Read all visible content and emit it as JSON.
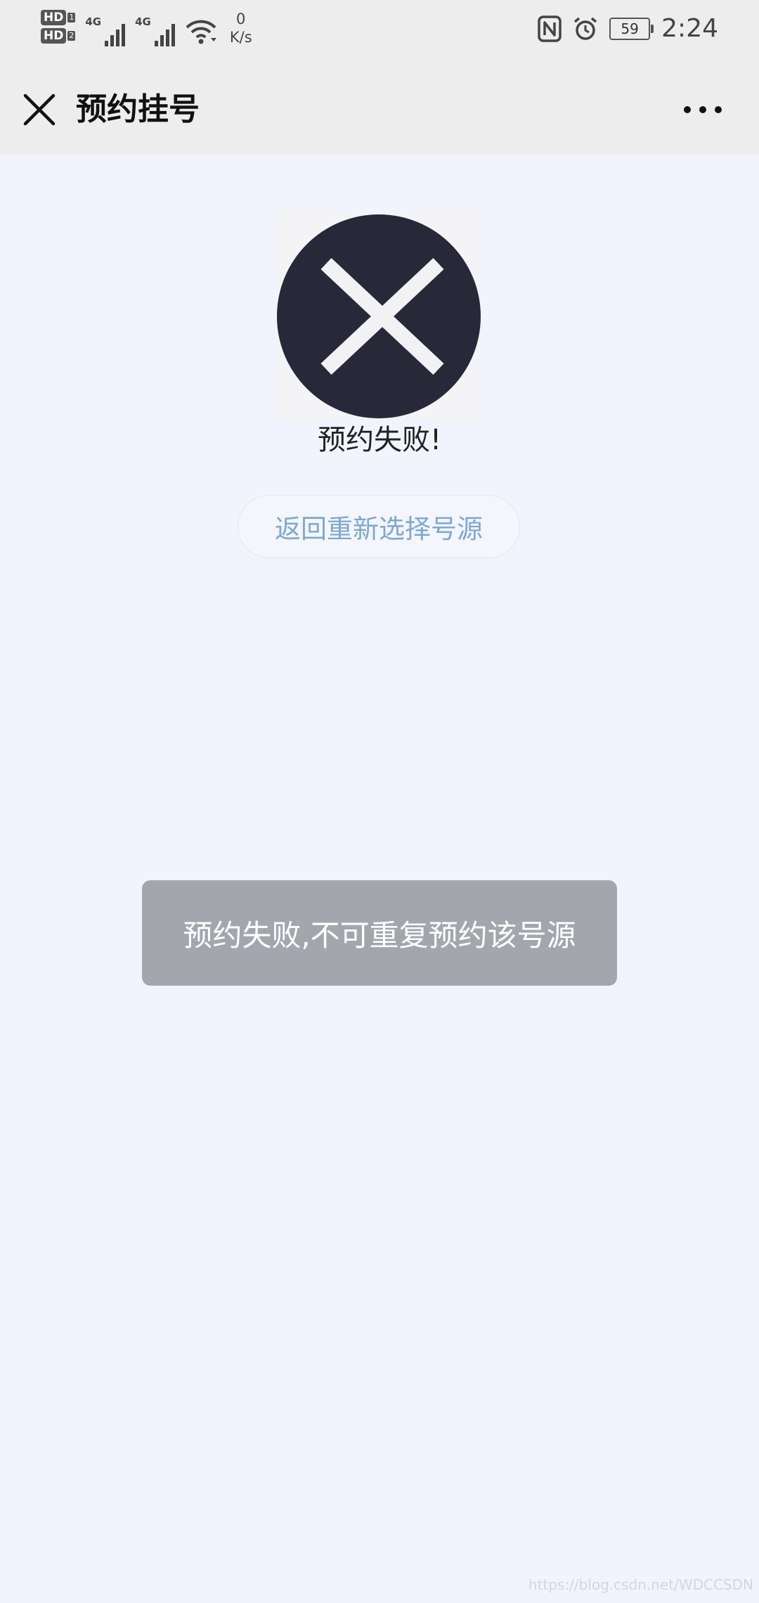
{
  "status_bar": {
    "sim1": "HD",
    "sim1_num": "1",
    "sim2": "HD",
    "sim2_num": "2",
    "gen1": "4G",
    "gen2": "4G",
    "speed_value": "0",
    "speed_unit": "K/s",
    "battery": "59",
    "time": "2:24"
  },
  "nav": {
    "title": "预约挂号"
  },
  "result": {
    "message": "预约失败!",
    "back_button": "返回重新选择号源"
  },
  "toast": {
    "message": "预约失败,不可重复预约该号源"
  },
  "watermark": "https://blog.csdn.net/WDCCSDN",
  "colors": {
    "page_bg": "#f2f4fd",
    "bar_bg": "#ededed",
    "fail_circle": "#272838",
    "link_blue": "#7ba9d3",
    "toast_bg": "#a4a6ae"
  }
}
